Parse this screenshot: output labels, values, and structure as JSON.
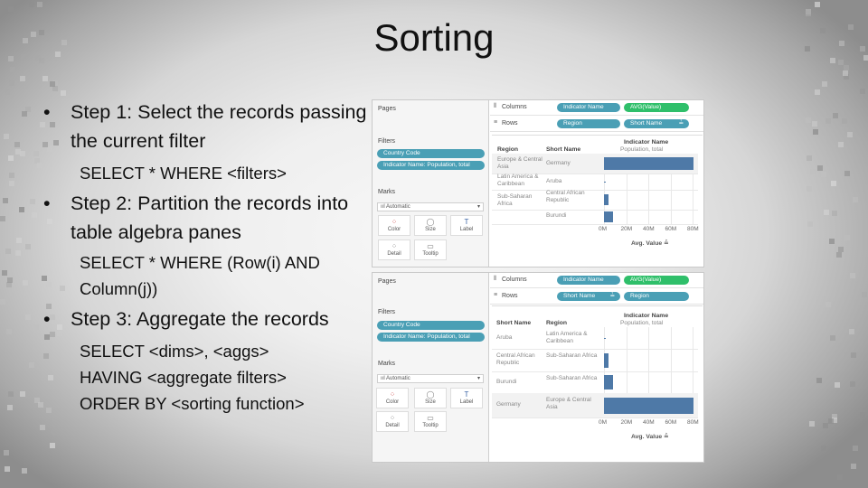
{
  "slide": {
    "title": "Sorting",
    "bullet_glyph": "•",
    "steps": [
      {
        "label": "Step 1: Select the records passing the current filter",
        "code": [
          "SELECT * WHERE <filters>"
        ]
      },
      {
        "label": "Step 2: Partition the records into table algebra panes",
        "code": [
          "SELECT * WHERE (Row(i) AND",
          "Column(j))"
        ]
      },
      {
        "label": "Step 3: Aggregate the records",
        "code": [
          "SELECT <dims>, <aggs>",
          "HAVING <aggregate filters>",
          "ORDER BY <sorting function>"
        ]
      }
    ]
  },
  "colors": {
    "teal_pill": "#4a9fb5",
    "green_pill": "#2fbf6a",
    "bar": "#4e79a7"
  },
  "screenshots": [
    {
      "pages_label": "Pages",
      "filters_label": "Filters",
      "filters": [
        "Country Code",
        "Indicator Name: Population, total"
      ],
      "marks_label": "Marks",
      "marks_type": "Automatic",
      "mark_buttons": [
        {
          "label": "Color",
          "icon": "color-dots-icon"
        },
        {
          "label": "Size",
          "icon": "size-icon"
        },
        {
          "label": "Label",
          "icon": "label-icon"
        },
        {
          "label": "Detail",
          "icon": "detail-icon"
        },
        {
          "label": "Tooltip",
          "icon": "tooltip-icon"
        }
      ],
      "columns_label": "Columns",
      "rows_label": "Rows",
      "column_pills": [
        "Indicator Name",
        "AVG(Value)"
      ],
      "row_pills": [
        "Region",
        "Short Name"
      ],
      "header_left": "Region",
      "header_mid": "Short Name",
      "header_top": "Indicator Name",
      "header_sub": "Population, total",
      "axis_label": "Avg. Value",
      "sort_icon": "≟",
      "ticks": [
        "0M",
        "20M",
        "40M",
        "60M",
        "80M"
      ],
      "chart_data": {
        "type": "bar",
        "categories": [
          "Germany",
          "Aruba",
          "Central African Republic",
          "Burundi"
        ],
        "groups": [
          "Europe & Central Asia",
          "Latin America & Caribbean",
          "Sub-Saharan Africa",
          "Sub-Saharan Africa"
        ],
        "values": [
          81,
          0.1,
          4.4,
          8.5
        ],
        "xlabel": "Avg. Value",
        "xlim": [
          0,
          80
        ]
      }
    },
    {
      "pages_label": "Pages",
      "filters_label": "Filters",
      "filters": [
        "Country Code",
        "Indicator Name: Population, total"
      ],
      "marks_label": "Marks",
      "marks_type": "Automatic",
      "mark_buttons": [
        {
          "label": "Color",
          "icon": "color-dots-icon"
        },
        {
          "label": "Size",
          "icon": "size-icon"
        },
        {
          "label": "Label",
          "icon": "label-icon"
        },
        {
          "label": "Detail",
          "icon": "detail-icon"
        },
        {
          "label": "Tooltip",
          "icon": "tooltip-icon"
        }
      ],
      "columns_label": "Columns",
      "rows_label": "Rows",
      "column_pills": [
        "Indicator Name",
        "AVG(Value)"
      ],
      "row_pills": [
        "Short Name",
        "Region"
      ],
      "header_left": "Short Name",
      "header_mid": "Region",
      "header_top": "Indicator Name",
      "header_sub": "Population, total",
      "axis_label": "Avg. Value",
      "sort_icon": "≟",
      "ticks": [
        "0M",
        "20M",
        "40M",
        "60M",
        "80M"
      ],
      "chart_data": {
        "type": "bar",
        "categories": [
          "Aruba",
          "Central African Republic",
          "Burundi",
          "Germany"
        ],
        "groups": [
          "Latin America & Caribbean",
          "Sub-Saharan Africa",
          "Sub-Saharan Africa",
          "Europe & Central Asia"
        ],
        "values": [
          0.1,
          4.4,
          8.5,
          81
        ],
        "xlabel": "Avg. Value",
        "xlim": [
          0,
          80
        ]
      }
    }
  ]
}
